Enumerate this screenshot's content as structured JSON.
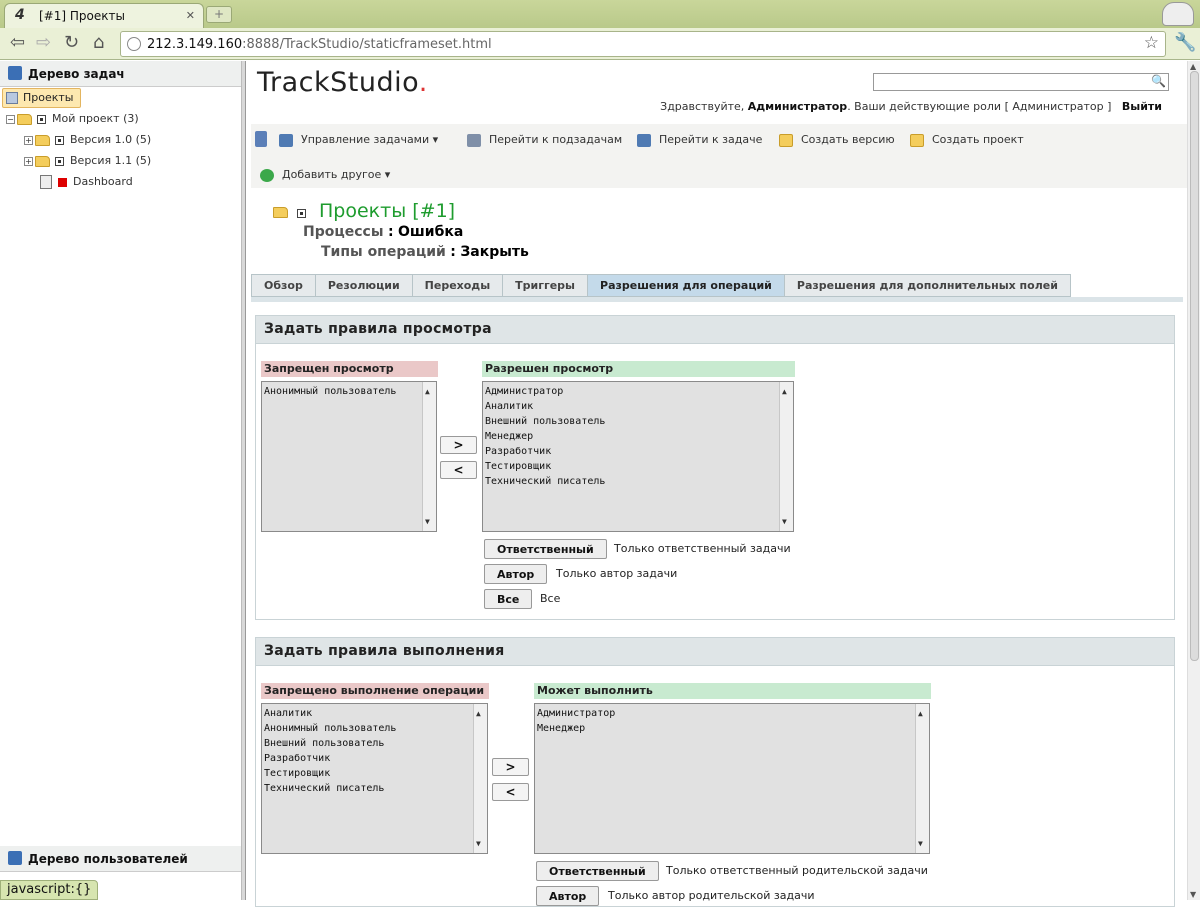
{
  "browser": {
    "tab_title": "[#1] Проекты",
    "tab_favicon": "4",
    "url_host": "212.3.149.160",
    "url_rest": ":8888/TrackStudio/staticframeset.html"
  },
  "left": {
    "task_tree_title": "Дерево задач",
    "root": "Проекты",
    "nodes": [
      "Мой проект (3)",
      "Версия 1.0 (5)",
      "Версия 1.1 (5)",
      "Dashboard"
    ],
    "user_tree_title": "Дерево пользователей",
    "status": "javascript:{}"
  },
  "header": {
    "logo": "TrackStudio",
    "logo_dot": ".",
    "greeting_prefix": "Здравствуйте,",
    "user": "Администратор",
    "roles_text": ". Ваши действующие роли  [ Администратор ]",
    "logout": "Выйти"
  },
  "actions": {
    "manage": "Управление задачами",
    "subtasks": "Перейти к подзадачам",
    "goto_task": "Перейти к задаче",
    "create_version": "Создать версию",
    "create_project": "Создать проект",
    "add_other": "Добавить другое"
  },
  "breadcrumb": {
    "title": "Проекты  [#1]",
    "process_key": "Процессы",
    "process_val": "Ошибка",
    "optype_key": "Типы операций",
    "optype_val": "Закрыть",
    "sep": ":"
  },
  "tabs": [
    "Обзор",
    "Резолюции",
    "Переходы",
    "Триггеры",
    "Разрешения для операций",
    "Разрешения для дополнительных полей"
  ],
  "view_section": {
    "title": "Задать правила просмотра",
    "denied_label": "Запрещен просмотр",
    "denied_items": [
      "Анонимный пользователь"
    ],
    "allowed_label": "Разрешен просмотр",
    "allowed_items": [
      "Администратор",
      "Аналитик",
      "Внешний пользователь",
      "Менеджер",
      "Разработчик",
      "Тестировщик",
      "Технический писатель"
    ],
    "move_right": ">",
    "move_left": "<",
    "btn_resp": "Ответственный",
    "desc_resp": "Только ответственный задачи",
    "btn_author": "Автор",
    "desc_author": "Только автор задачи",
    "btn_all": "Все",
    "desc_all": "Все"
  },
  "exec_section": {
    "title": "Задать правила выполнения",
    "denied_label": "Запрещено выполнение операции",
    "denied_items": [
      "Аналитик",
      "Анонимный пользователь",
      "Внешний пользователь",
      "Разработчик",
      "Тестировщик",
      "Технический писатель"
    ],
    "allowed_label": "Может выполнить",
    "allowed_items": [
      "Администратор",
      "Менеджер"
    ],
    "move_right": ">",
    "move_left": "<",
    "btn_resp": "Ответственный",
    "desc_resp": "Только ответственный родительской задачи",
    "btn_author": "Автор",
    "desc_author": "Только автор родительской задачи"
  },
  "colors": {
    "accent_green": "#1e9c2e",
    "denied_bg": "#eac8c8",
    "allowed_bg": "#c8ead0",
    "active_tab": "#c4daea"
  }
}
